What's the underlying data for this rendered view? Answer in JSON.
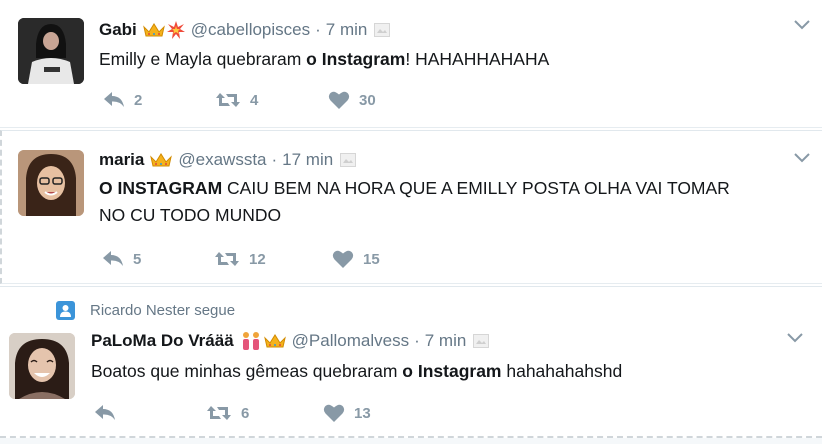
{
  "tweets": [
    {
      "name": "Gabi",
      "handle": "@cabellopisces",
      "time": "7 min",
      "text_before": "Emilly e Mayla quebraram ",
      "text_bold": "o Instagram",
      "text_after": "! HAHAHHAHAHA",
      "replies": "2",
      "retweets": "4",
      "likes": "30"
    },
    {
      "name": "maria",
      "handle": "@exawssta",
      "time": "17 min",
      "text_bold": "O INSTAGRAM",
      "text_line1_after": " CAIU BEM NA HORA QUE A EMILLY POSTA OLHA VAI TOMAR",
      "text_line2": "NO CU TODO MUNDO",
      "replies": "5",
      "retweets": "12",
      "likes": "15"
    },
    {
      "context": "Ricardo Nester segue",
      "name": "PaLoMa Do Vráää",
      "handle": "@Pallomalvess",
      "time": "7 min",
      "text_before": "Boatos que minhas gêmeas quebraram ",
      "text_bold": "o Instagram",
      "text_after": " hahahahahshd",
      "retweets": "6",
      "likes": "13"
    }
  ],
  "separator": "·",
  "icons": [
    "reply-icon",
    "retweet-icon",
    "like-icon",
    "chevron-down-icon",
    "crown-emoji-icon",
    "collision-emoji-icon",
    "people-emoji-icon",
    "user-follow-icon",
    "placeholder-image-icon"
  ],
  "colors": {
    "action_gray": "#8899a6",
    "secondary_text": "#657786",
    "follow_blue": "#3b94d9"
  }
}
